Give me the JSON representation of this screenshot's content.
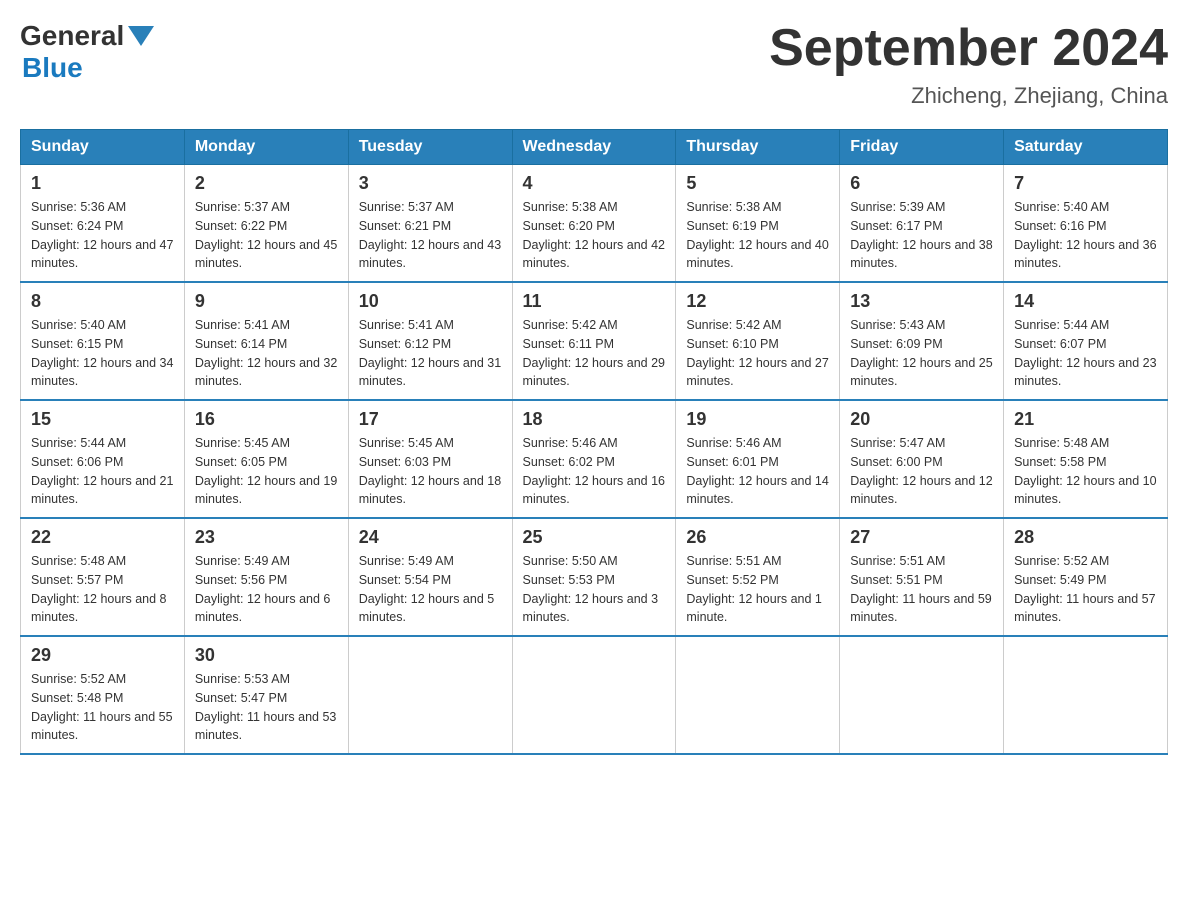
{
  "header": {
    "logo_general": "General",
    "logo_blue": "Blue",
    "title": "September 2024",
    "subtitle": "Zhicheng, Zhejiang, China"
  },
  "days_of_week": [
    "Sunday",
    "Monday",
    "Tuesday",
    "Wednesday",
    "Thursday",
    "Friday",
    "Saturday"
  ],
  "weeks": [
    [
      {
        "day": "1",
        "sunrise": "Sunrise: 5:36 AM",
        "sunset": "Sunset: 6:24 PM",
        "daylight": "Daylight: 12 hours and 47 minutes."
      },
      {
        "day": "2",
        "sunrise": "Sunrise: 5:37 AM",
        "sunset": "Sunset: 6:22 PM",
        "daylight": "Daylight: 12 hours and 45 minutes."
      },
      {
        "day": "3",
        "sunrise": "Sunrise: 5:37 AM",
        "sunset": "Sunset: 6:21 PM",
        "daylight": "Daylight: 12 hours and 43 minutes."
      },
      {
        "day": "4",
        "sunrise": "Sunrise: 5:38 AM",
        "sunset": "Sunset: 6:20 PM",
        "daylight": "Daylight: 12 hours and 42 minutes."
      },
      {
        "day": "5",
        "sunrise": "Sunrise: 5:38 AM",
        "sunset": "Sunset: 6:19 PM",
        "daylight": "Daylight: 12 hours and 40 minutes."
      },
      {
        "day": "6",
        "sunrise": "Sunrise: 5:39 AM",
        "sunset": "Sunset: 6:17 PM",
        "daylight": "Daylight: 12 hours and 38 minutes."
      },
      {
        "day": "7",
        "sunrise": "Sunrise: 5:40 AM",
        "sunset": "Sunset: 6:16 PM",
        "daylight": "Daylight: 12 hours and 36 minutes."
      }
    ],
    [
      {
        "day": "8",
        "sunrise": "Sunrise: 5:40 AM",
        "sunset": "Sunset: 6:15 PM",
        "daylight": "Daylight: 12 hours and 34 minutes."
      },
      {
        "day": "9",
        "sunrise": "Sunrise: 5:41 AM",
        "sunset": "Sunset: 6:14 PM",
        "daylight": "Daylight: 12 hours and 32 minutes."
      },
      {
        "day": "10",
        "sunrise": "Sunrise: 5:41 AM",
        "sunset": "Sunset: 6:12 PM",
        "daylight": "Daylight: 12 hours and 31 minutes."
      },
      {
        "day": "11",
        "sunrise": "Sunrise: 5:42 AM",
        "sunset": "Sunset: 6:11 PM",
        "daylight": "Daylight: 12 hours and 29 minutes."
      },
      {
        "day": "12",
        "sunrise": "Sunrise: 5:42 AM",
        "sunset": "Sunset: 6:10 PM",
        "daylight": "Daylight: 12 hours and 27 minutes."
      },
      {
        "day": "13",
        "sunrise": "Sunrise: 5:43 AM",
        "sunset": "Sunset: 6:09 PM",
        "daylight": "Daylight: 12 hours and 25 minutes."
      },
      {
        "day": "14",
        "sunrise": "Sunrise: 5:44 AM",
        "sunset": "Sunset: 6:07 PM",
        "daylight": "Daylight: 12 hours and 23 minutes."
      }
    ],
    [
      {
        "day": "15",
        "sunrise": "Sunrise: 5:44 AM",
        "sunset": "Sunset: 6:06 PM",
        "daylight": "Daylight: 12 hours and 21 minutes."
      },
      {
        "day": "16",
        "sunrise": "Sunrise: 5:45 AM",
        "sunset": "Sunset: 6:05 PM",
        "daylight": "Daylight: 12 hours and 19 minutes."
      },
      {
        "day": "17",
        "sunrise": "Sunrise: 5:45 AM",
        "sunset": "Sunset: 6:03 PM",
        "daylight": "Daylight: 12 hours and 18 minutes."
      },
      {
        "day": "18",
        "sunrise": "Sunrise: 5:46 AM",
        "sunset": "Sunset: 6:02 PM",
        "daylight": "Daylight: 12 hours and 16 minutes."
      },
      {
        "day": "19",
        "sunrise": "Sunrise: 5:46 AM",
        "sunset": "Sunset: 6:01 PM",
        "daylight": "Daylight: 12 hours and 14 minutes."
      },
      {
        "day": "20",
        "sunrise": "Sunrise: 5:47 AM",
        "sunset": "Sunset: 6:00 PM",
        "daylight": "Daylight: 12 hours and 12 minutes."
      },
      {
        "day": "21",
        "sunrise": "Sunrise: 5:48 AM",
        "sunset": "Sunset: 5:58 PM",
        "daylight": "Daylight: 12 hours and 10 minutes."
      }
    ],
    [
      {
        "day": "22",
        "sunrise": "Sunrise: 5:48 AM",
        "sunset": "Sunset: 5:57 PM",
        "daylight": "Daylight: 12 hours and 8 minutes."
      },
      {
        "day": "23",
        "sunrise": "Sunrise: 5:49 AM",
        "sunset": "Sunset: 5:56 PM",
        "daylight": "Daylight: 12 hours and 6 minutes."
      },
      {
        "day": "24",
        "sunrise": "Sunrise: 5:49 AM",
        "sunset": "Sunset: 5:54 PM",
        "daylight": "Daylight: 12 hours and 5 minutes."
      },
      {
        "day": "25",
        "sunrise": "Sunrise: 5:50 AM",
        "sunset": "Sunset: 5:53 PM",
        "daylight": "Daylight: 12 hours and 3 minutes."
      },
      {
        "day": "26",
        "sunrise": "Sunrise: 5:51 AM",
        "sunset": "Sunset: 5:52 PM",
        "daylight": "Daylight: 12 hours and 1 minute."
      },
      {
        "day": "27",
        "sunrise": "Sunrise: 5:51 AM",
        "sunset": "Sunset: 5:51 PM",
        "daylight": "Daylight: 11 hours and 59 minutes."
      },
      {
        "day": "28",
        "sunrise": "Sunrise: 5:52 AM",
        "sunset": "Sunset: 5:49 PM",
        "daylight": "Daylight: 11 hours and 57 minutes."
      }
    ],
    [
      {
        "day": "29",
        "sunrise": "Sunrise: 5:52 AM",
        "sunset": "Sunset: 5:48 PM",
        "daylight": "Daylight: 11 hours and 55 minutes."
      },
      {
        "day": "30",
        "sunrise": "Sunrise: 5:53 AM",
        "sunset": "Sunset: 5:47 PM",
        "daylight": "Daylight: 11 hours and 53 minutes."
      },
      null,
      null,
      null,
      null,
      null
    ]
  ]
}
